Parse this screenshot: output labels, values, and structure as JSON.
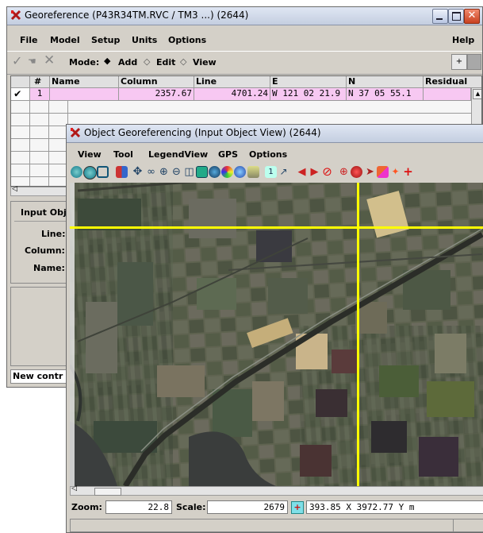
{
  "main_window": {
    "title": "Georeference (P43R34TM.RVC / TM3 ...) (2644)",
    "menu": [
      "File",
      "Model",
      "Setup",
      "Units",
      "Options"
    ],
    "help": "Help",
    "mode_label": "Mode:",
    "modes": [
      "Add",
      "Edit",
      "View"
    ],
    "selected_mode": "Add",
    "table": {
      "headers": [
        "#",
        "Name",
        "Column",
        "Line",
        "E",
        "N",
        "Residual"
      ],
      "rows": [
        {
          "check": "✔",
          "num": "1",
          "name": "",
          "column": "2357.67",
          "line": "4701.24",
          "e": "W 121 02 21.9",
          "n": "N  37 05 55.1",
          "residual": ""
        }
      ]
    },
    "input_panel": {
      "title": "Input Obj",
      "line_label": "Line:",
      "column_label": "Column:",
      "name_label": "Name:"
    },
    "status": "New contr"
  },
  "object_window": {
    "title": "Object Georeferencing (Input Object View) (2644)",
    "menu": [
      "View",
      "Tool",
      "LegendView",
      "GPS",
      "Options"
    ],
    "toolbar_icons": [
      "redraw-icon",
      "redraw-selected-icon",
      "fit-icon",
      "pan-arrows-icon",
      "move-icon",
      "binoculars-icon",
      "zoom-in-icon",
      "zoom-out-icon",
      "zoom-box-icon",
      "full-extent-icon",
      "globe-icon",
      "palette-icon",
      "globe-blue-icon",
      "camera-icon",
      "scale-1-icon",
      "measure-icon",
      "back-arrow-icon",
      "forward-arrow-icon",
      "no-entry-icon",
      "zoom-red-icon",
      "stop-icon",
      "select-arrow-icon",
      "paint-icon",
      "sparkle-icon",
      "add-point-icon"
    ],
    "zoom_label": "Zoom:",
    "zoom_value": "22.8",
    "scale_label": "Scale:",
    "scale_value": "2679",
    "coords": "393.85 X  3972.77 Y m",
    "crosshair": {
      "vertical_at": 0.68,
      "horizontal_at": 0.14
    }
  },
  "colors": {
    "title_bar": "#c8d2e6",
    "pink_row": "#f7c8f2",
    "crosshair": "#ffff00",
    "window_bg": "#d4d0c8"
  }
}
